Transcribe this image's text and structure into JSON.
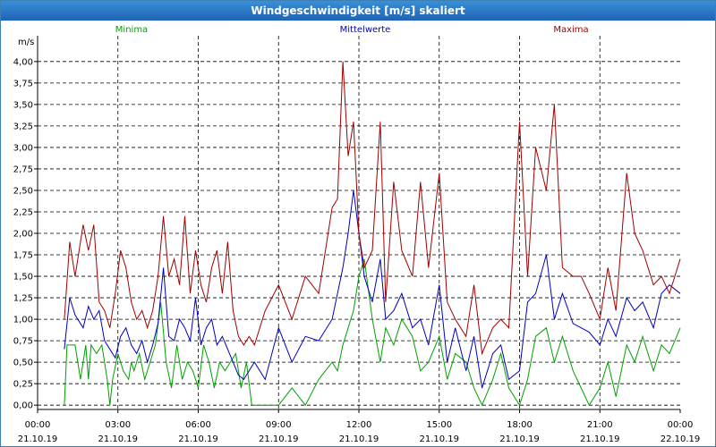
{
  "window": {
    "title": "Windgeschwindigkeit [m/s] skaliert"
  },
  "chart_data": {
    "type": "line",
    "title": "Windgeschwindigkeit [m/s] skaliert",
    "ylabel": "m/s",
    "ylim": [
      -0.05,
      4.3
    ],
    "xlim": [
      0,
      24
    ],
    "y_ticks": [
      "0,00",
      "0,25",
      "0,50",
      "0,75",
      "1,00",
      "1,25",
      "1,50",
      "1,75",
      "2,00",
      "2,25",
      "2,50",
      "2,75",
      "3,00",
      "3,25",
      "3,50",
      "3,75",
      "4,00"
    ],
    "x_ticks": [
      {
        "time": "00:00",
        "date": "21.10.19"
      },
      {
        "time": "03:00",
        "date": "21.10.19"
      },
      {
        "time": "06:00",
        "date": "21.10.19"
      },
      {
        "time": "09:00",
        "date": "21.10.19"
      },
      {
        "time": "12:00",
        "date": "21.10.19"
      },
      {
        "time": "15:00",
        "date": "21.10.19"
      },
      {
        "time": "18:00",
        "date": "21.10.19"
      },
      {
        "time": "21:00",
        "date": "21.10.19"
      },
      {
        "time": "00:00",
        "date": "22.10.19"
      }
    ],
    "grid": true,
    "legend_position": "top",
    "series": [
      {
        "name": "Minima",
        "color": "#00a000",
        "x": [
          1,
          1.1,
          1.4,
          1.6,
          1.8,
          1.9,
          2.0,
          2.2,
          2.4,
          2.6,
          2.7,
          2.8,
          3.0,
          3.2,
          3.4,
          3.5,
          3.6,
          3.8,
          4.0,
          4.2,
          4.4,
          4.6,
          4.8,
          5.0,
          5.2,
          5.4,
          5.6,
          5.8,
          6.0,
          6.2,
          6.4,
          6.6,
          6.8,
          7.0,
          7.2,
          7.4,
          7.6,
          7.8,
          8.0,
          8.5,
          9.0,
          9.5,
          10.0,
          10.5,
          11.0,
          11.2,
          11.4,
          11.6,
          11.8,
          12.0,
          12.2,
          12.5,
          12.8,
          13.0,
          13.3,
          13.6,
          14.0,
          14.3,
          14.6,
          15.0,
          15.3,
          15.6,
          16.0,
          16.3,
          16.6,
          17.0,
          17.3,
          17.6,
          18.0,
          18.3,
          18.6,
          19.0,
          19.3,
          19.6,
          20.0,
          20.3,
          20.6,
          21.0,
          21.3,
          21.6,
          22.0,
          22.3,
          22.6,
          23.0,
          23.3,
          23.6,
          24.0
        ],
        "y": [
          0,
          0.7,
          0.7,
          0.3,
          0.7,
          0.3,
          0.7,
          0.6,
          0.7,
          0.3,
          0,
          0.3,
          0.6,
          0.4,
          0.3,
          0.5,
          0.4,
          0.6,
          0.3,
          0.5,
          0.7,
          1.2,
          0.5,
          0.2,
          0.7,
          0.3,
          0.5,
          0.4,
          0.2,
          0.7,
          0.5,
          0.2,
          0.5,
          0.4,
          0.5,
          0.6,
          0.2,
          0.5,
          0,
          0,
          0,
          0.2,
          0,
          0.3,
          0.5,
          0.4,
          0.7,
          0.9,
          1.1,
          1.5,
          1.7,
          1.0,
          0.5,
          0.9,
          0.7,
          1.0,
          0.8,
          0.4,
          0.5,
          0.8,
          0.3,
          0.6,
          0.5,
          0.2,
          0,
          0.3,
          0.6,
          0.2,
          0,
          0.3,
          0.8,
          0.9,
          0.5,
          0.8,
          0.4,
          0.2,
          0,
          0.2,
          0.5,
          0.1,
          0.7,
          0.5,
          0.8,
          0.4,
          0.7,
          0.6,
          0.9
        ]
      },
      {
        "name": "Mittelwerte",
        "color": "#0000c0",
        "x": [
          1,
          1.2,
          1.4,
          1.7,
          1.9,
          2.1,
          2.3,
          2.5,
          2.7,
          2.9,
          3.1,
          3.3,
          3.5,
          3.7,
          3.9,
          4.1,
          4.3,
          4.5,
          4.7,
          4.9,
          5.1,
          5.3,
          5.5,
          5.7,
          5.9,
          6.1,
          6.3,
          6.5,
          6.7,
          6.9,
          7.1,
          7.3,
          7.5,
          7.7,
          7.9,
          8.1,
          8.5,
          9.0,
          9.5,
          10.0,
          10.5,
          11.0,
          11.2,
          11.4,
          11.6,
          11.8,
          12.0,
          12.2,
          12.5,
          12.8,
          13.0,
          13.3,
          13.6,
          14.0,
          14.3,
          14.6,
          15.0,
          15.3,
          15.6,
          16.0,
          16.3,
          16.6,
          17.0,
          17.3,
          17.6,
          18.0,
          18.3,
          18.6,
          19.0,
          19.3,
          19.6,
          20.0,
          20.3,
          20.6,
          21.0,
          21.3,
          21.6,
          22.0,
          22.3,
          22.6,
          23.0,
          23.3,
          23.6,
          24.0
        ],
        "y": [
          0.65,
          1.25,
          1.05,
          0.9,
          1.15,
          1.0,
          1.1,
          0.75,
          0.65,
          0.55,
          0.8,
          0.9,
          0.7,
          0.6,
          0.75,
          0.5,
          0.7,
          0.95,
          1.6,
          0.8,
          0.75,
          1.0,
          0.9,
          0.75,
          1.25,
          0.7,
          0.9,
          1.0,
          0.7,
          0.8,
          0.65,
          0.5,
          0.35,
          0.3,
          0.4,
          0.5,
          0.3,
          0.9,
          0.5,
          0.8,
          0.75,
          1.0,
          1.3,
          1.6,
          2.0,
          2.5,
          2.0,
          1.5,
          1.2,
          1.7,
          1.0,
          1.1,
          1.3,
          0.9,
          1.0,
          0.7,
          1.4,
          0.5,
          0.9,
          0.4,
          0.8,
          0.2,
          0.6,
          0.7,
          0.3,
          0.4,
          1.2,
          1.3,
          1.75,
          1.0,
          1.3,
          0.95,
          0.9,
          0.85,
          0.7,
          1.0,
          0.8,
          1.25,
          1.1,
          1.2,
          0.9,
          1.3,
          1.4,
          1.3
        ]
      },
      {
        "name": "Maxima",
        "color": "#a00000",
        "x": [
          1,
          1.2,
          1.4,
          1.7,
          1.9,
          2.1,
          2.3,
          2.5,
          2.7,
          2.9,
          3.1,
          3.3,
          3.5,
          3.7,
          3.9,
          4.1,
          4.3,
          4.5,
          4.7,
          4.9,
          5.1,
          5.3,
          5.5,
          5.7,
          5.9,
          6.1,
          6.3,
          6.5,
          6.7,
          6.9,
          7.1,
          7.3,
          7.5,
          7.7,
          7.9,
          8.1,
          8.5,
          9.0,
          9.5,
          10.0,
          10.5,
          11.0,
          11.2,
          11.4,
          11.6,
          11.8,
          12.0,
          12.2,
          12.5,
          12.8,
          13.0,
          13.3,
          13.6,
          14.0,
          14.3,
          14.6,
          15.0,
          15.3,
          15.6,
          16.0,
          16.3,
          16.6,
          17.0,
          17.3,
          17.6,
          18.0,
          18.3,
          18.6,
          19.0,
          19.3,
          19.6,
          20.0,
          20.3,
          20.6,
          21.0,
          21.3,
          21.6,
          22.0,
          22.3,
          22.6,
          23.0,
          23.3,
          23.6,
          24.0
        ],
        "y": [
          1.0,
          1.9,
          1.5,
          2.1,
          1.8,
          2.1,
          1.2,
          1.1,
          0.9,
          1.3,
          1.8,
          1.6,
          1.2,
          1.0,
          1.1,
          0.9,
          1.1,
          1.5,
          2.2,
          1.5,
          1.7,
          1.4,
          2.2,
          1.3,
          1.8,
          1.4,
          1.2,
          1.6,
          1.8,
          1.3,
          1.9,
          1.1,
          0.8,
          0.7,
          0.8,
          0.7,
          1.1,
          1.4,
          1.0,
          1.5,
          1.3,
          2.3,
          2.4,
          4.0,
          2.9,
          3.3,
          2.0,
          1.6,
          1.8,
          3.3,
          1.2,
          2.6,
          1.8,
          1.5,
          2.6,
          1.6,
          2.7,
          1.2,
          1.0,
          0.8,
          1.4,
          0.6,
          0.9,
          1.0,
          0.9,
          3.3,
          1.5,
          3.0,
          2.5,
          3.5,
          1.6,
          1.5,
          1.5,
          1.3,
          1.0,
          1.6,
          1.1,
          2.7,
          2.0,
          1.8,
          1.4,
          1.5,
          1.3,
          1.7
        ]
      }
    ]
  }
}
